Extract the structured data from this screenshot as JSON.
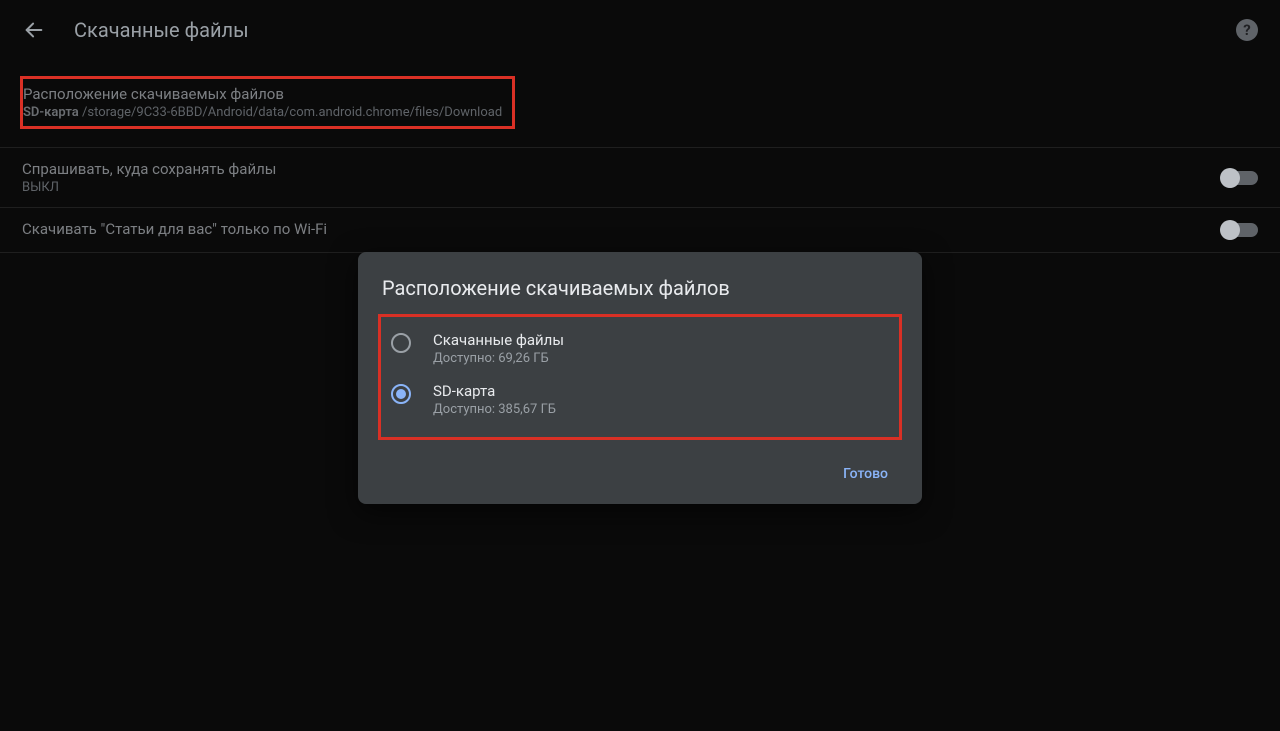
{
  "header": {
    "title": "Скачанные файлы"
  },
  "settings": {
    "location": {
      "label": "Расположение скачиваемых файлов",
      "storage_prefix": "SD-карта",
      "path": "/storage/9C33-6BBD/Android/data/com.android.chrome/files/Download"
    },
    "ask": {
      "label": "Спрашивать, куда сохранять файлы",
      "state": "ВЫКЛ",
      "enabled": false
    },
    "wifi": {
      "label": "Скачивать \"Статьи для вас\" только по Wi-Fi",
      "enabled": false
    }
  },
  "dialog": {
    "title": "Расположение скачиваемых файлов",
    "options": [
      {
        "label": "Скачанные файлы",
        "detail": "Доступно: 69,26 ГБ",
        "selected": false
      },
      {
        "label": "SD-карта",
        "detail": "Доступно: 385,67 ГБ",
        "selected": true
      }
    ],
    "done": "Готово"
  }
}
